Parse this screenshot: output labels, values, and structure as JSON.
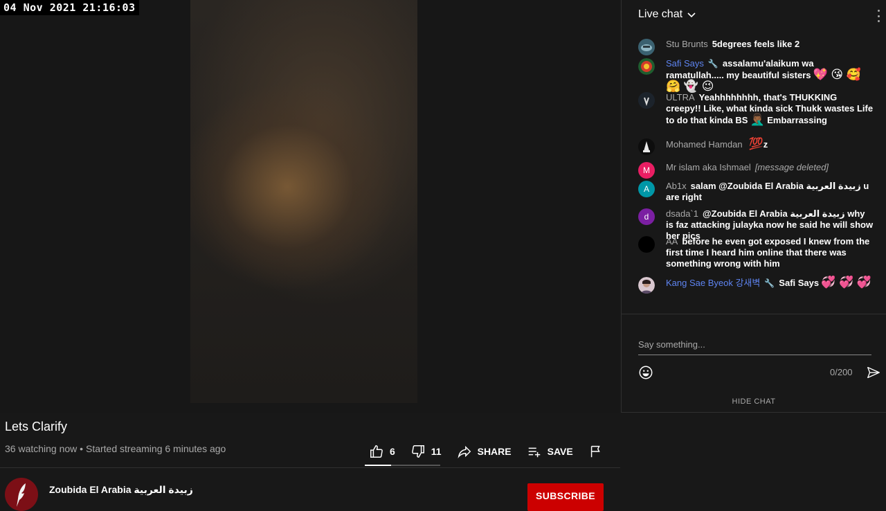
{
  "overlay": {
    "timestamp": "04 Nov 2021 21:16:03"
  },
  "video": {
    "title": "Lets Clarify",
    "watching": "36 watching now",
    "separator": " • ",
    "started": "Started streaming 6 minutes ago",
    "likes": "6",
    "dislikes": "11",
    "like_ratio": 0.35,
    "share_label": "SHARE",
    "save_label": "SAVE"
  },
  "channel": {
    "name": "Zoubida El Arabia زبيدة العربية",
    "subscribe_label": "SUBSCRIBE"
  },
  "chat": {
    "header": "Live chat",
    "messages": [
      {
        "author": "Stu Brunts",
        "text": "5degrees feels like 2",
        "avatar": ""
      },
      {
        "author": "Safi Says",
        "text": "assalamu'alaikum wa ramatullah..... my beautiful sisters",
        "emojis": "💖 😘 🥰 🤗 👻 😉",
        "moderator": true
      },
      {
        "author": "ULTRA",
        "text": "Yeahhhhhhhh, that's THUKKING creepy!! Like, what kinda sick Thukk wastes Life to do that kinda BS",
        "emojis": "🤦🏾‍♂️",
        "text2": "Embarrassing"
      },
      {
        "author": "Mohamed Hamdan",
        "text": "z",
        "emojis": "💯"
      },
      {
        "author": "Mr islam aka Ishmael",
        "text": "[message deleted]",
        "avatar": "M"
      },
      {
        "author": "Ab1x",
        "text": "salam @Zoubida El Arabia زبيدة العربية u are right",
        "avatar": "A"
      },
      {
        "author": "dsada`1",
        "text": "@Zoubida El Arabia زبيدة العربية why is faz attacking julayka now he said he will show her pics",
        "avatar": "d"
      },
      {
        "author": "AA",
        "text": "before he even got exposed I knew from the first time I heard him online that there was something wrong with him"
      },
      {
        "author": "Kang Sae Byeok 강새벽",
        "text": "Safi Says",
        "emojis": "💞 💞 💞",
        "moderator": true
      }
    ],
    "input_placeholder": "Say something...",
    "char_count": "0/200",
    "hide_label": "HIDE CHAT"
  },
  "colors": {
    "subscribe": "#cc0000",
    "moderator": "#5e84f1",
    "background": "#181818"
  }
}
